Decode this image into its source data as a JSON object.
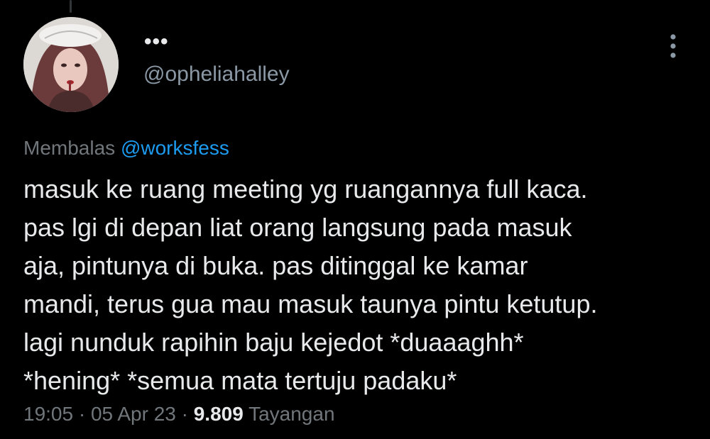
{
  "tweet": {
    "display_name": "•••",
    "handle": "@opheliahalley",
    "reply_prefix": "Membalas",
    "reply_mention": "@worksfess",
    "text": "masuk ke ruang meeting yg ruangannya full kaca.\npas lgi di depan liat orang langsung pada masuk\naja, pintunya di buka. pas ditinggal ke kamar\nmandi, terus gua mau masuk taunya pintu ketutup.\nlagi nunduk rapihin baju kejedot *duaaaghh*\n*hening* *semua mata tertuju padaku*",
    "time": "19:05",
    "date": "05 Apr 23",
    "separator": "·",
    "views_count": "9.809",
    "views_label": "Tayangan"
  },
  "icons": {
    "more": "more-vertical-icon"
  },
  "colors": {
    "background": "#000000",
    "primary_text": "#e7e9ea",
    "secondary_text": "#71767b",
    "mention": "#1d9bf0"
  }
}
